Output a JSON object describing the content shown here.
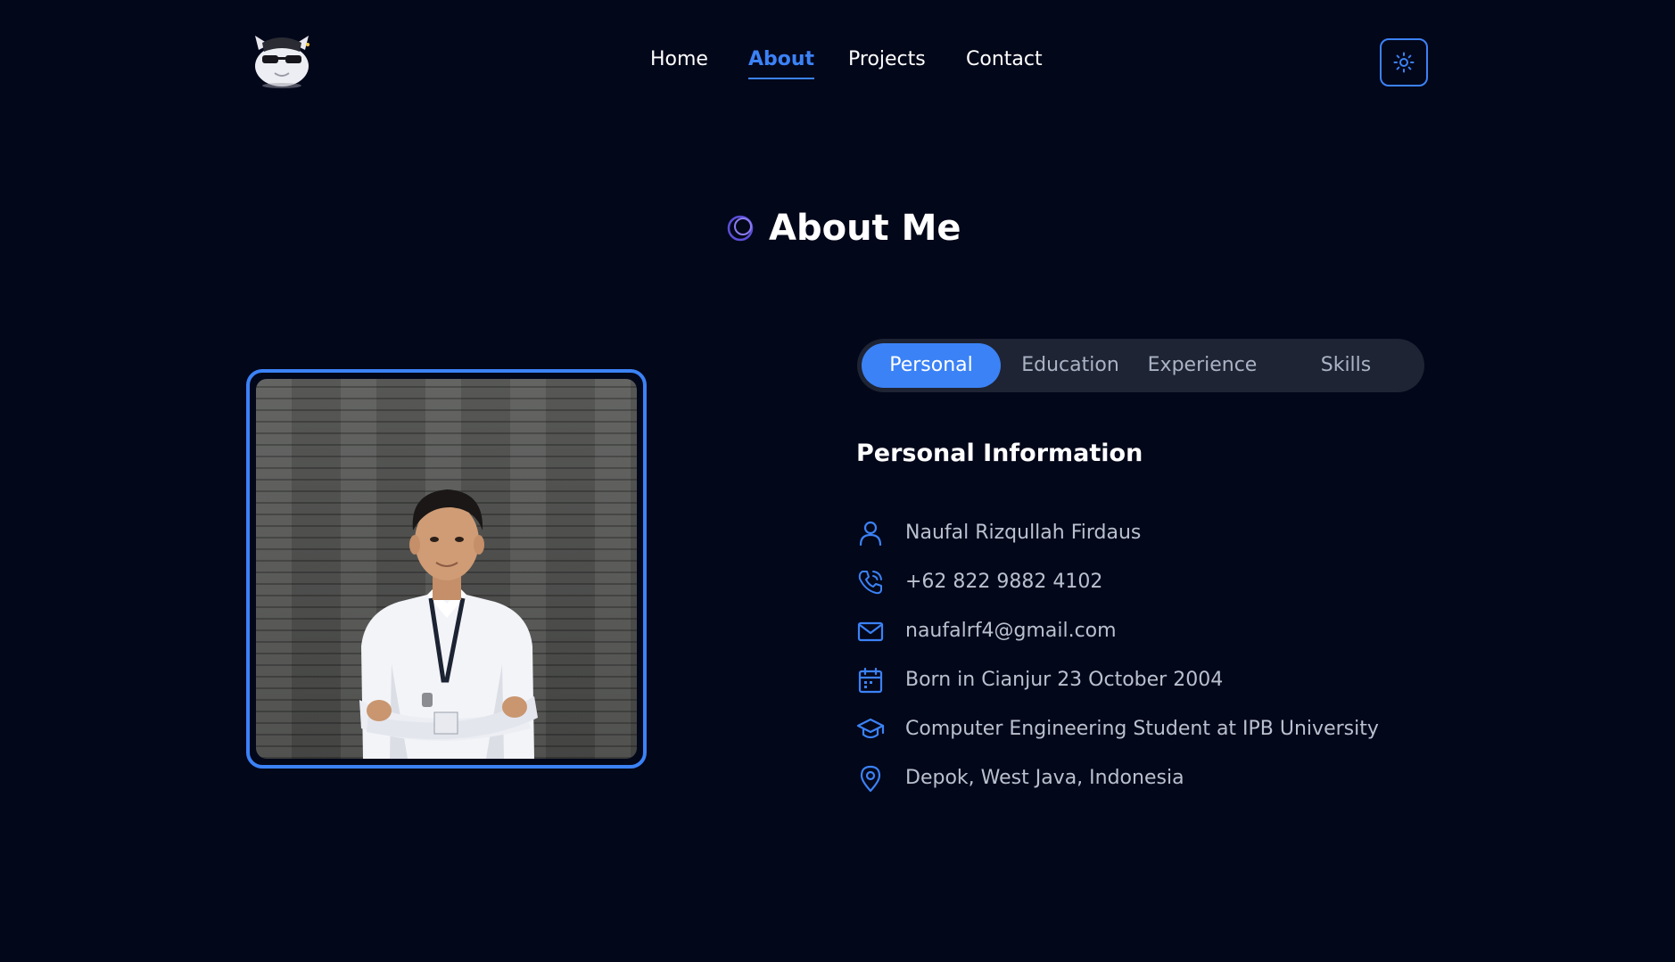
{
  "nav": {
    "items": [
      {
        "label": "Home",
        "active": false
      },
      {
        "label": "About",
        "active": true
      },
      {
        "label": "Projects",
        "active": false
      },
      {
        "label": "Contact",
        "active": false
      }
    ]
  },
  "theme_toggle": {
    "icon": "sun-icon"
  },
  "hero": {
    "title": "About Me",
    "icon": "orbit-icon"
  },
  "tabs": [
    {
      "label": "Personal",
      "active": true
    },
    {
      "label": "Education",
      "active": false
    },
    {
      "label": "Experience",
      "active": false
    },
    {
      "label": "Skills",
      "active": false
    }
  ],
  "personal": {
    "heading": "Personal Information",
    "items": [
      {
        "icon": "user-icon",
        "text": "Naufal Rizqullah Firdaus"
      },
      {
        "icon": "phone-icon",
        "text": "+62 822 9882 4102"
      },
      {
        "icon": "mail-icon",
        "text": "naufalrf4@gmail.com"
      },
      {
        "icon": "calendar-icon",
        "text": "Born in Cianjur 23 October 2004"
      },
      {
        "icon": "graduation-cap-icon",
        "text": "Computer Engineering Student at IPB University"
      },
      {
        "icon": "map-pin-icon",
        "text": "Depok, West Java, Indonesia"
      }
    ]
  },
  "colors": {
    "accent": "#3b82f6",
    "background": "#03071a",
    "tab_bg": "#1e2433",
    "muted_text": "#b9c0ce"
  }
}
